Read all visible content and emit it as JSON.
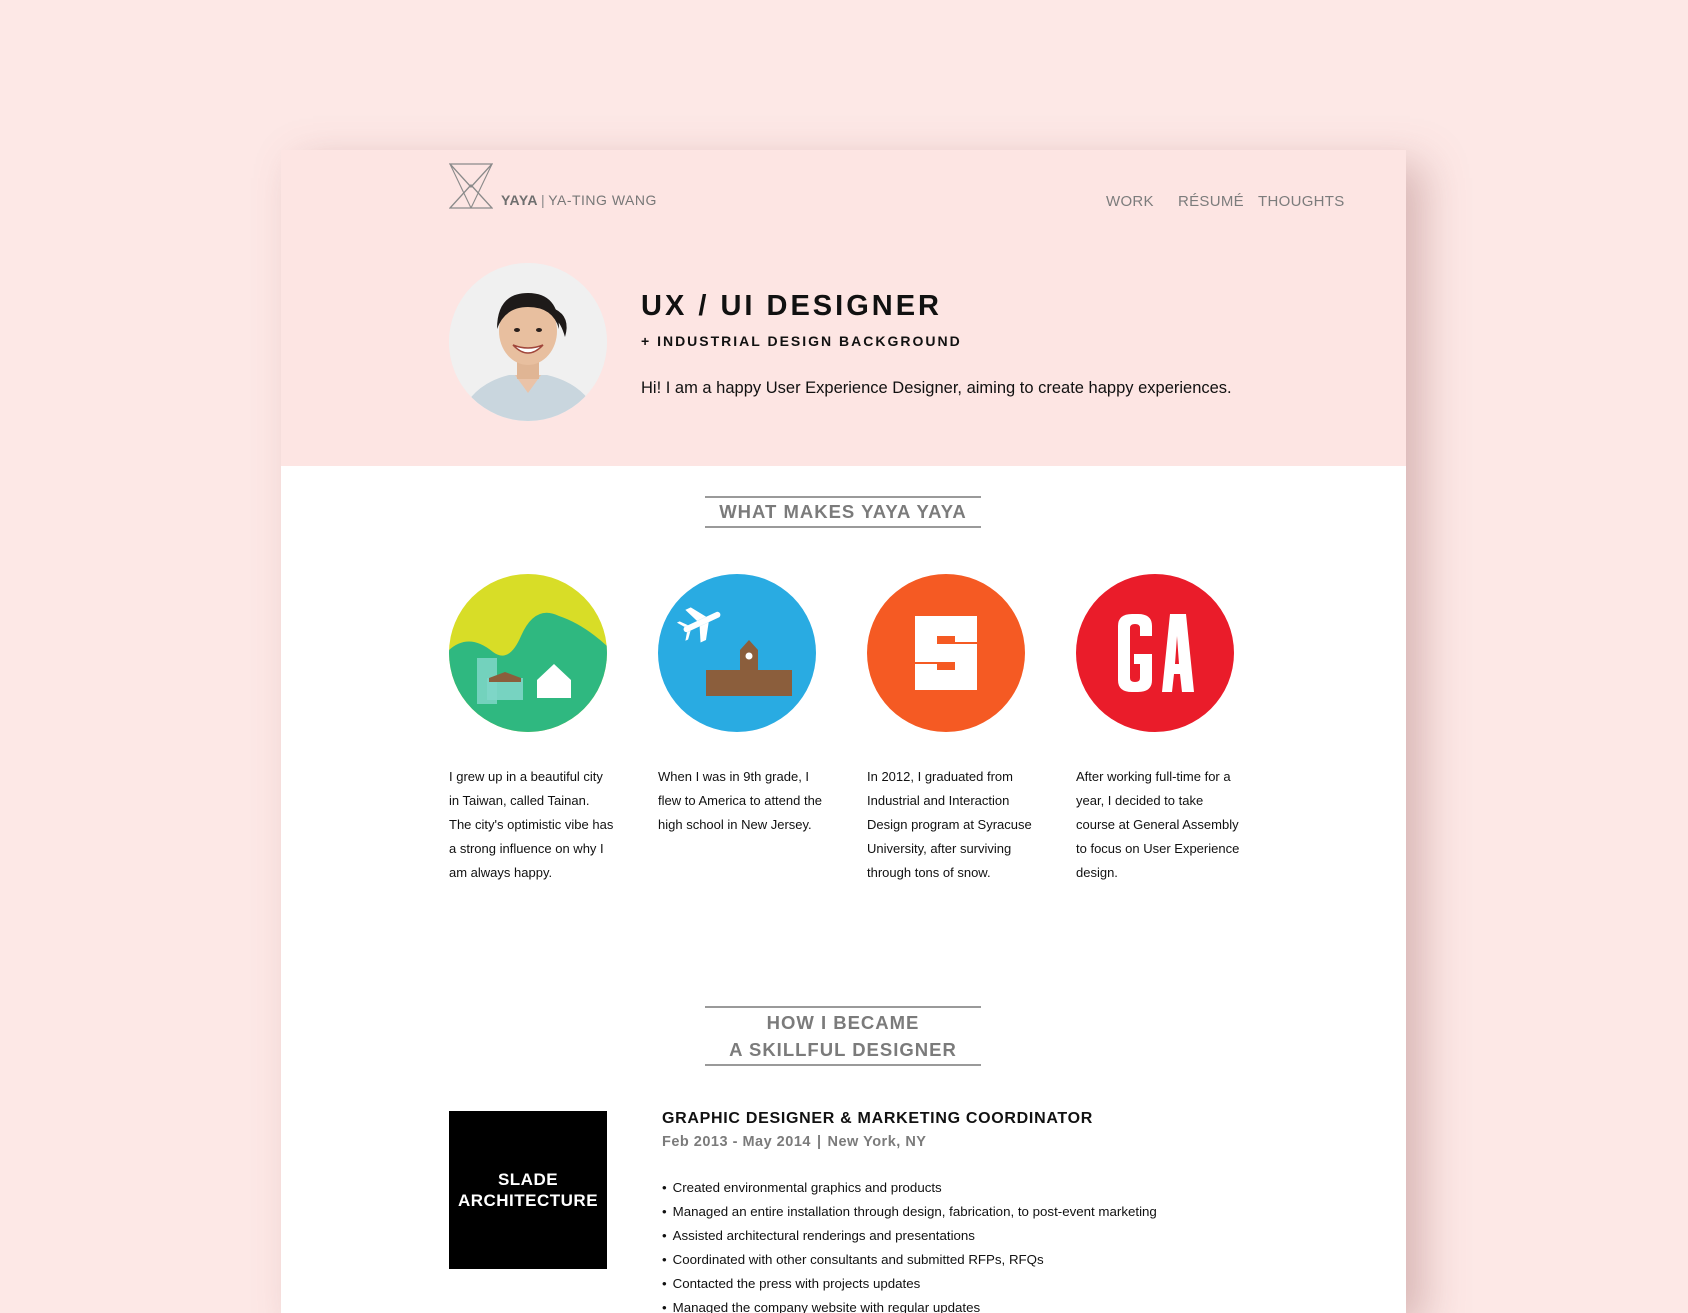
{
  "brand": {
    "short": "YAYA",
    "separator": "|",
    "full": "YA-TING WANG"
  },
  "nav": {
    "items": [
      "WORK",
      "RÉSUMÉ",
      "THOUGHTS"
    ]
  },
  "hero": {
    "title": "UX / UI DESIGNER",
    "subtitle": "+ INDUSTRIAL DESIGN BACKGROUND",
    "intro": "Hi! I am a happy User Experience Designer, aiming to create happy experiences."
  },
  "about": {
    "title": "WHAT MAKES YAYA YAYA",
    "items": [
      {
        "icon": "tainan-landscape-icon",
        "text": "I grew up in a beautiful city in Taiwan, called Tainan. The city's optimistic vibe has a strong influence on why I am always happy."
      },
      {
        "icon": "airplane-school-icon",
        "text": "When I was in 9th grade, I flew to America to attend the high school in New Jersey."
      },
      {
        "icon": "syracuse-s-icon",
        "text": "In 2012, I graduated from Industrial and Interaction Design program at Syracuse University, after surviving through tons of snow."
      },
      {
        "icon": "general-assembly-ga-icon",
        "text": "After working full-time for a year, I decided to take course at General Assembly to focus on User Experience design."
      }
    ]
  },
  "experience": {
    "title_line1": "HOW I BECAME",
    "title_line2": "A SKILLFUL DESIGNER",
    "jobs": [
      {
        "company_line1": "SLADE",
        "company_line2": "ARCHITECTURE",
        "title": "GRAPHIC DESIGNER & MARKETING COORDINATOR",
        "dates": "Feb 2013 - May 2014",
        "meta_separator": "|",
        "location": "New York, NY",
        "duties": [
          "Created environmental graphics and products",
          "Managed an entire installation through design, fabrication, to post-event marketing",
          "Assisted architectural renderings and presentations",
          "Coordinated with other consultants and submitted RFPs, RFQs",
          "Contacted the press with projects updates",
          "Managed the company website with regular updates"
        ]
      }
    ]
  },
  "colors": {
    "background": "#fde8e6",
    "hero_bg": "#fde5e3",
    "tainan_sky": "#d8dd27",
    "tainan_hills": "#2fb880",
    "travel_blue": "#29abe2",
    "school_brown": "#8b5e3c",
    "syracuse_orange": "#f55a23",
    "ga_red": "#ea1c2a"
  }
}
